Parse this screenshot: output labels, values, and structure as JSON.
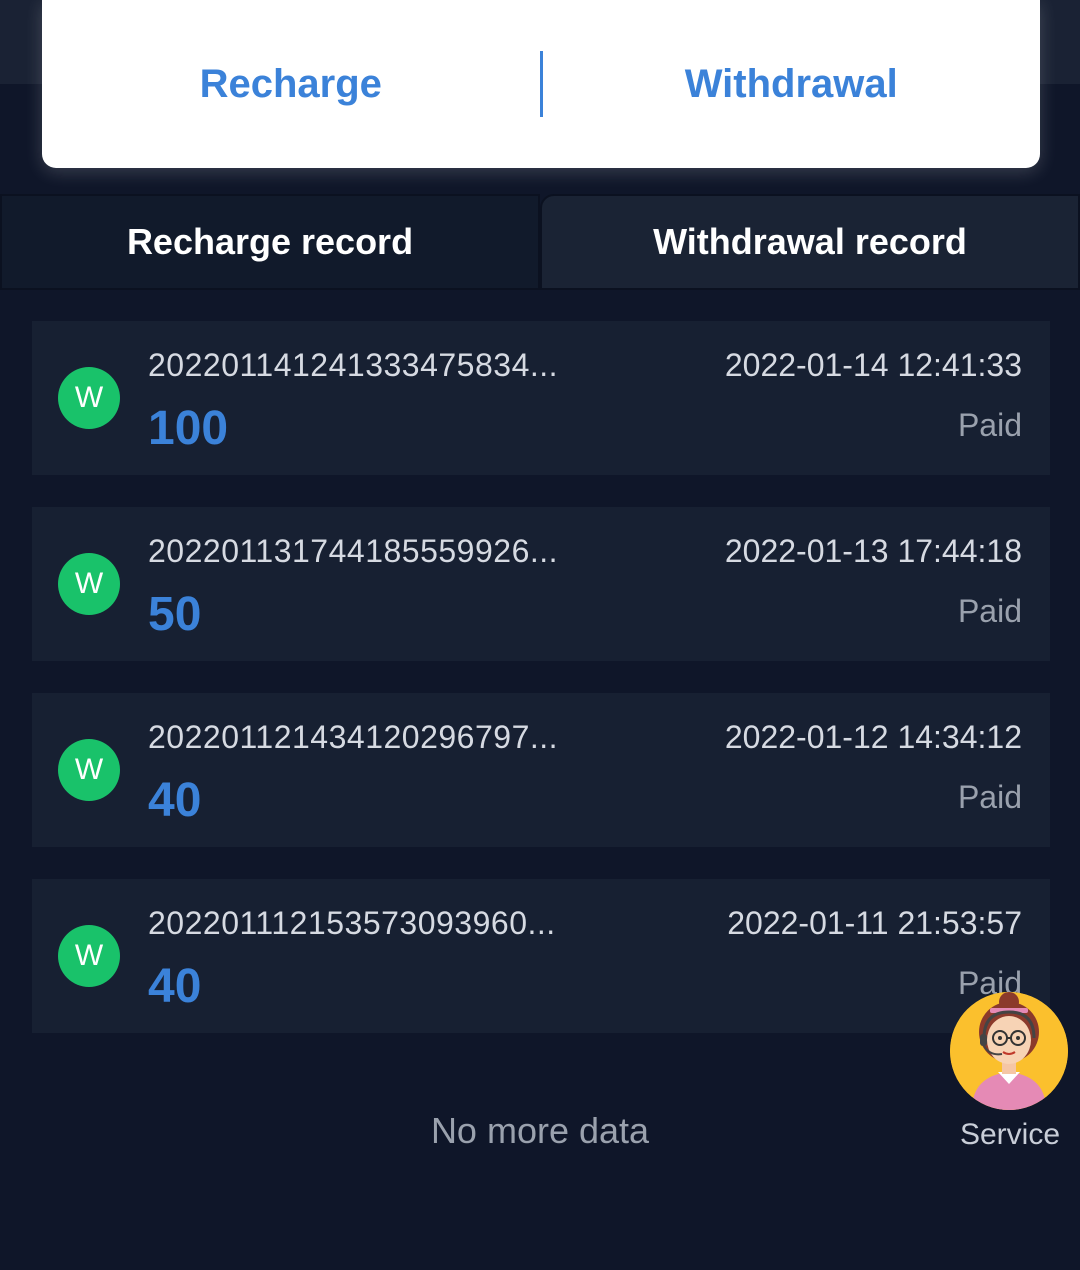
{
  "actions": {
    "recharge_label": "Recharge",
    "withdrawal_label": "Withdrawal"
  },
  "tabs": [
    {
      "label": "Recharge record",
      "active": false
    },
    {
      "label": "Withdrawal record",
      "active": true
    }
  ],
  "records": [
    {
      "badge": "W",
      "order_id": "202201141241333475834...",
      "amount": "100",
      "time": "2022-01-14 12:41:33",
      "status": "Paid"
    },
    {
      "badge": "W",
      "order_id": "202201131744185559926...",
      "amount": "50",
      "time": "2022-01-13 17:44:18",
      "status": "Paid"
    },
    {
      "badge": "W",
      "order_id": "202201121434120296797...",
      "amount": "40",
      "time": "2022-01-12 14:34:12",
      "status": "Paid"
    },
    {
      "badge": "W",
      "order_id": "202201112153573093960...",
      "amount": "40",
      "time": "2022-01-11 21:53:57",
      "status": "Paid"
    }
  ],
  "footer": {
    "no_more_text": "No more data"
  },
  "service": {
    "label": "Service",
    "icon": "customer-service-agent-icon"
  },
  "colors": {
    "accent": "#3b82d9",
    "badge_green": "#19c26a",
    "background": "#0f1629",
    "card": "#172032"
  }
}
